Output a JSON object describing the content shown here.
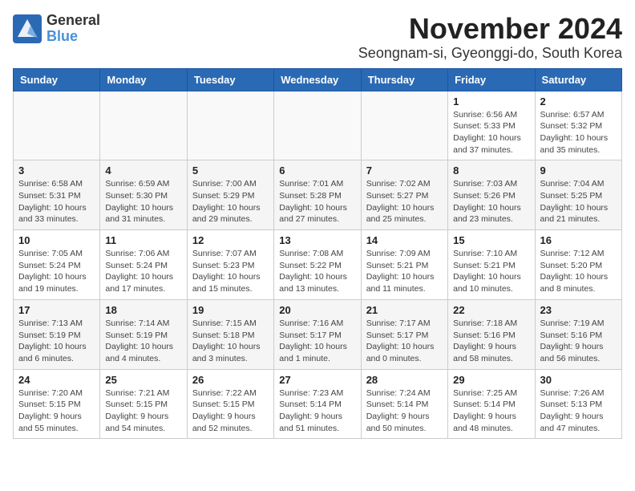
{
  "header": {
    "logo_line1": "General",
    "logo_line2": "Blue",
    "month": "November 2024",
    "location": "Seongnam-si, Gyeonggi-do, South Korea"
  },
  "weekdays": [
    "Sunday",
    "Monday",
    "Tuesday",
    "Wednesday",
    "Thursday",
    "Friday",
    "Saturday"
  ],
  "weeks": [
    [
      {
        "day": "",
        "info": ""
      },
      {
        "day": "",
        "info": ""
      },
      {
        "day": "",
        "info": ""
      },
      {
        "day": "",
        "info": ""
      },
      {
        "day": "",
        "info": ""
      },
      {
        "day": "1",
        "info": "Sunrise: 6:56 AM\nSunset: 5:33 PM\nDaylight: 10 hours\nand 37 minutes."
      },
      {
        "day": "2",
        "info": "Sunrise: 6:57 AM\nSunset: 5:32 PM\nDaylight: 10 hours\nand 35 minutes."
      }
    ],
    [
      {
        "day": "3",
        "info": "Sunrise: 6:58 AM\nSunset: 5:31 PM\nDaylight: 10 hours\nand 33 minutes."
      },
      {
        "day": "4",
        "info": "Sunrise: 6:59 AM\nSunset: 5:30 PM\nDaylight: 10 hours\nand 31 minutes."
      },
      {
        "day": "5",
        "info": "Sunrise: 7:00 AM\nSunset: 5:29 PM\nDaylight: 10 hours\nand 29 minutes."
      },
      {
        "day": "6",
        "info": "Sunrise: 7:01 AM\nSunset: 5:28 PM\nDaylight: 10 hours\nand 27 minutes."
      },
      {
        "day": "7",
        "info": "Sunrise: 7:02 AM\nSunset: 5:27 PM\nDaylight: 10 hours\nand 25 minutes."
      },
      {
        "day": "8",
        "info": "Sunrise: 7:03 AM\nSunset: 5:26 PM\nDaylight: 10 hours\nand 23 minutes."
      },
      {
        "day": "9",
        "info": "Sunrise: 7:04 AM\nSunset: 5:25 PM\nDaylight: 10 hours\nand 21 minutes."
      }
    ],
    [
      {
        "day": "10",
        "info": "Sunrise: 7:05 AM\nSunset: 5:24 PM\nDaylight: 10 hours\nand 19 minutes."
      },
      {
        "day": "11",
        "info": "Sunrise: 7:06 AM\nSunset: 5:24 PM\nDaylight: 10 hours\nand 17 minutes."
      },
      {
        "day": "12",
        "info": "Sunrise: 7:07 AM\nSunset: 5:23 PM\nDaylight: 10 hours\nand 15 minutes."
      },
      {
        "day": "13",
        "info": "Sunrise: 7:08 AM\nSunset: 5:22 PM\nDaylight: 10 hours\nand 13 minutes."
      },
      {
        "day": "14",
        "info": "Sunrise: 7:09 AM\nSunset: 5:21 PM\nDaylight: 10 hours\nand 11 minutes."
      },
      {
        "day": "15",
        "info": "Sunrise: 7:10 AM\nSunset: 5:21 PM\nDaylight: 10 hours\nand 10 minutes."
      },
      {
        "day": "16",
        "info": "Sunrise: 7:12 AM\nSunset: 5:20 PM\nDaylight: 10 hours\nand 8 minutes."
      }
    ],
    [
      {
        "day": "17",
        "info": "Sunrise: 7:13 AM\nSunset: 5:19 PM\nDaylight: 10 hours\nand 6 minutes."
      },
      {
        "day": "18",
        "info": "Sunrise: 7:14 AM\nSunset: 5:19 PM\nDaylight: 10 hours\nand 4 minutes."
      },
      {
        "day": "19",
        "info": "Sunrise: 7:15 AM\nSunset: 5:18 PM\nDaylight: 10 hours\nand 3 minutes."
      },
      {
        "day": "20",
        "info": "Sunrise: 7:16 AM\nSunset: 5:17 PM\nDaylight: 10 hours\nand 1 minute."
      },
      {
        "day": "21",
        "info": "Sunrise: 7:17 AM\nSunset: 5:17 PM\nDaylight: 10 hours\nand 0 minutes."
      },
      {
        "day": "22",
        "info": "Sunrise: 7:18 AM\nSunset: 5:16 PM\nDaylight: 9 hours\nand 58 minutes."
      },
      {
        "day": "23",
        "info": "Sunrise: 7:19 AM\nSunset: 5:16 PM\nDaylight: 9 hours\nand 56 minutes."
      }
    ],
    [
      {
        "day": "24",
        "info": "Sunrise: 7:20 AM\nSunset: 5:15 PM\nDaylight: 9 hours\nand 55 minutes."
      },
      {
        "day": "25",
        "info": "Sunrise: 7:21 AM\nSunset: 5:15 PM\nDaylight: 9 hours\nand 54 minutes."
      },
      {
        "day": "26",
        "info": "Sunrise: 7:22 AM\nSunset: 5:15 PM\nDaylight: 9 hours\nand 52 minutes."
      },
      {
        "day": "27",
        "info": "Sunrise: 7:23 AM\nSunset: 5:14 PM\nDaylight: 9 hours\nand 51 minutes."
      },
      {
        "day": "28",
        "info": "Sunrise: 7:24 AM\nSunset: 5:14 PM\nDaylight: 9 hours\nand 50 minutes."
      },
      {
        "day": "29",
        "info": "Sunrise: 7:25 AM\nSunset: 5:14 PM\nDaylight: 9 hours\nand 48 minutes."
      },
      {
        "day": "30",
        "info": "Sunrise: 7:26 AM\nSunset: 5:13 PM\nDaylight: 9 hours\nand 47 minutes."
      }
    ]
  ]
}
